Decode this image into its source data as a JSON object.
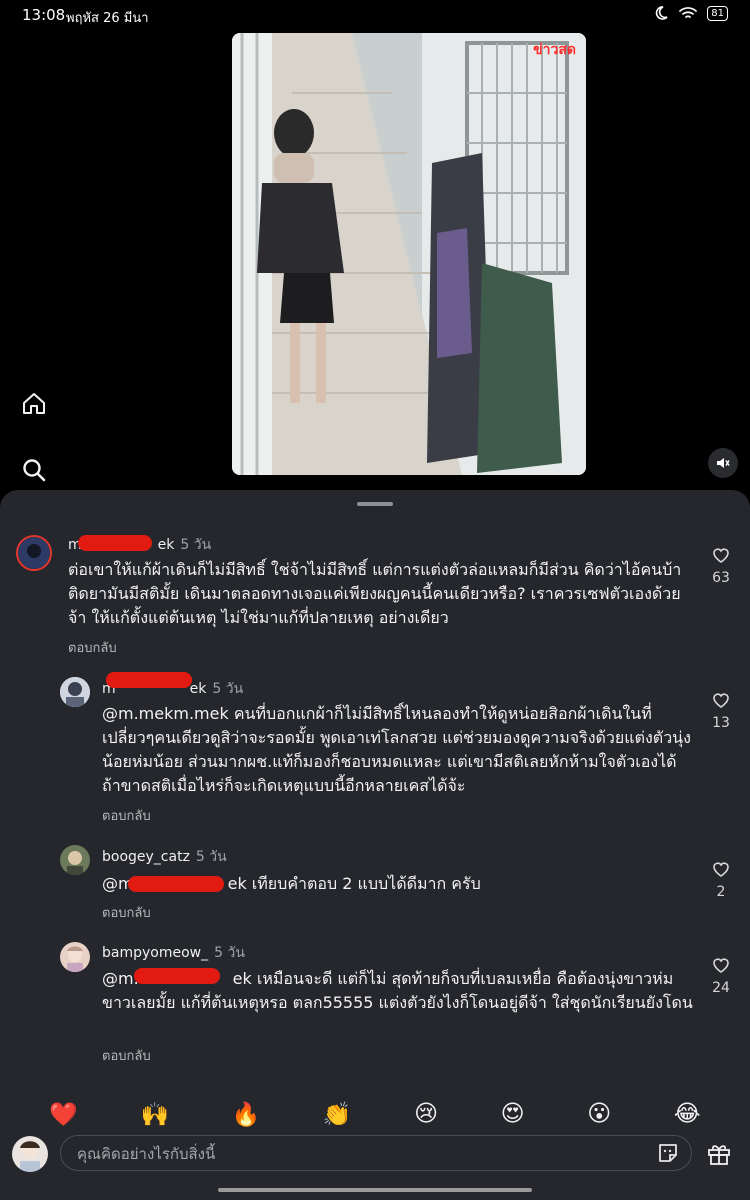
{
  "status_bar": {
    "time": "13:08",
    "date": "พฤหัส 26 มีนา",
    "battery": "81"
  },
  "video": {
    "watermark": "ข่าวสด"
  },
  "comments": [
    {
      "username_visible_start": "m",
      "username_visible_end": "ek",
      "time": "5 วัน",
      "text": "ต่อเขาให้แก้ผ้าเดินก็ไม่มีสิทธิ์ ใช่จ้าไม่มีสิทธิ์ แต่การแต่งตัวล่อแหลมก็มีส่วน คิดว่าไอ้คนบ้าติดยามันมีสติมั้ย เดินมาตลอดทางเจอแค่เพียงผญคนนี้คนเดียวหรือ? เราควรเซฟตัวเองด้วยจ้า ให้แก้ตั้งแต่ต้นเหตุ ไม่ใช่มาแก้ที่ปลายเหตุ อย่างเดียว",
      "reply_label": "ตอบกลับ",
      "likes": "63"
    },
    {
      "username_visible_start": "m",
      "username_visible_end": "ek",
      "time": "5 วัน",
      "text": "@m.mekm.mek  คนที่บอกแกผ้าก็ไม่มีสิทธิ์ไหนลองทำให้ดูหน่อยสิอกผ้าเดินในที่เปลี่ยวๆคนเดียวดูสิว่าจะรอดมั้ย  พูดเอาเท่โลกสวย แต่ช่วยมองดูความจริงด้วยแต่งตัวนุ่งน้อยห่มน้อย ส่วนมากผช.แท้ก็มองก็ชอบหมดแหละ แต่เขามีสติเลยหักห้ามใจตัวเองได้  ถ้าขาดสติเมื่อไหร่ก็จะเกิดเหตุแบบนี้อีกหลายเคสได้จ้ะ",
      "reply_label": "ตอบกลับ",
      "likes": "13"
    },
    {
      "username": "boogey_catz",
      "time": "5 วัน",
      "text_start": "@m",
      "text": "ek เทียบคำตอบ 2 แบบได้ดีมาก ครับ",
      "reply_label": "ตอบกลับ",
      "likes": "2"
    },
    {
      "username": "bampyomeow_",
      "time": "5 วัน",
      "text_start": "@m.",
      "text": "ek เหมือนจะดี แต่ก็ไม่ สุดท้ายก็จบที่เบลมเหยื่อ คือต้องนุ่งขาวห่มขาวเลยมั้ย แก้ที่ต้นเหตุหรอ ตลก55555 แต่งตัวยังไงก็โดนอยู่ดีจ้า ใส่ชุดนักเรียนยังโดน",
      "reply_label": "ตอบกลับ",
      "likes": "24"
    }
  ],
  "reactions": [
    "❤️",
    "🙌",
    "🔥",
    "👏",
    "😢",
    "😍",
    "😮",
    "😂"
  ],
  "composer": {
    "placeholder": "คุณคิดอย่างไรกับสิ่งนี้"
  },
  "icons": {
    "home": "home-icon",
    "search": "search-icon",
    "mute": "speaker-mute-icon",
    "heart": "heart-outline-icon",
    "sticker": "sticker-icon",
    "gift": "gift-icon"
  },
  "colors": {
    "sheet": "#25272c",
    "redaction": "#e21b12",
    "watermark": "#ff2e2e"
  }
}
